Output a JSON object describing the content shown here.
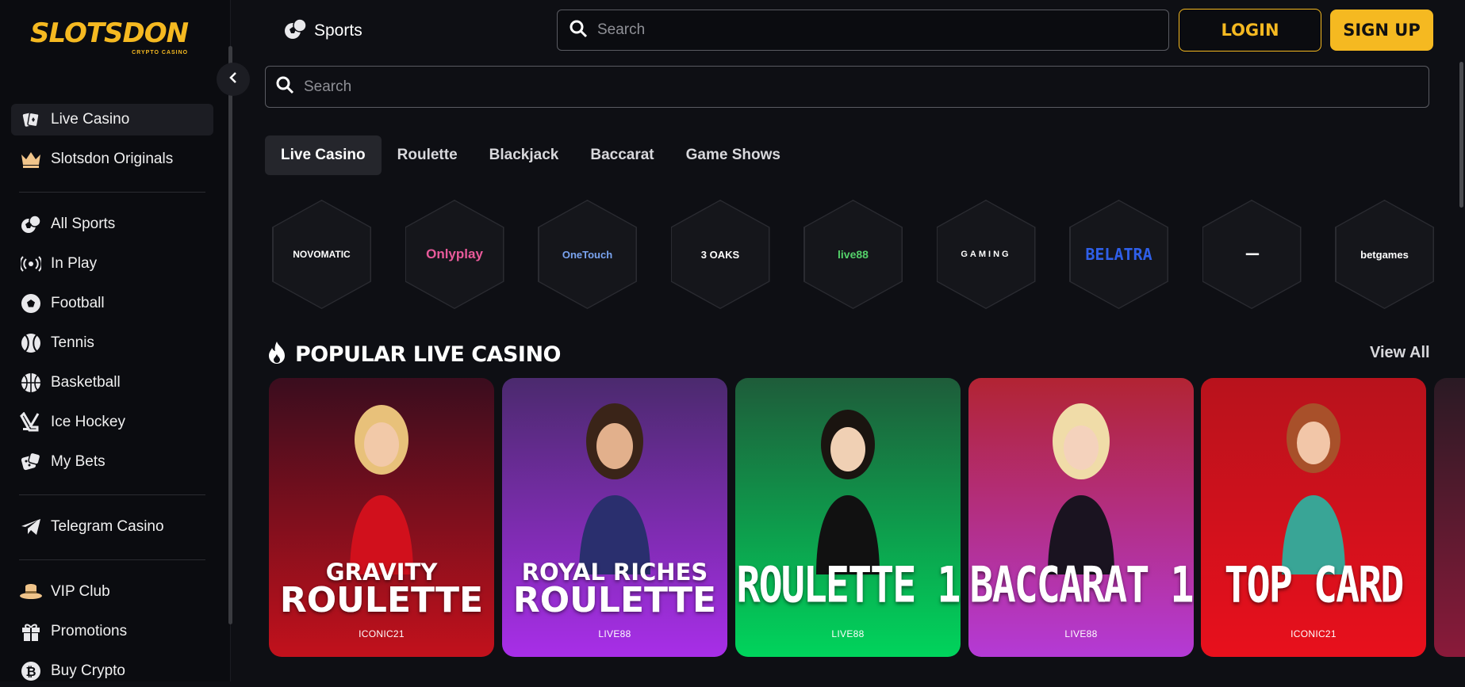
{
  "brand": {
    "name": "SLOTSDON",
    "tagline": "CRYPTO CASINO",
    "color": "#f5b921"
  },
  "header": {
    "sports_label": "Sports",
    "search_placeholder": "Search",
    "login_label": "LOGIN",
    "signup_label": "SIGN UP"
  },
  "sidebar": {
    "items": [
      {
        "label": "Live Casino",
        "icon": "live-casino-icon",
        "active": true
      },
      {
        "label": "Slotsdon Originals",
        "icon": "crown-icon"
      },
      {
        "label": "All Sports",
        "icon": "sports-icon"
      },
      {
        "label": "In Play",
        "icon": "broadcast-icon"
      },
      {
        "label": "Football",
        "icon": "football-icon"
      },
      {
        "label": "Tennis",
        "icon": "tennis-icon"
      },
      {
        "label": "Basketball",
        "icon": "basketball-icon"
      },
      {
        "label": "Ice Hockey",
        "icon": "hockey-icon"
      },
      {
        "label": "My Bets",
        "icon": "dice-icon"
      },
      {
        "label": "Telegram Casino",
        "icon": "telegram-icon"
      },
      {
        "label": "VIP Club",
        "icon": "vip-hat-icon"
      },
      {
        "label": "Promotions",
        "icon": "gift-icon"
      },
      {
        "label": "Buy Crypto",
        "icon": "bitcoin-icon"
      }
    ]
  },
  "main": {
    "search_placeholder": "Search",
    "tabs": [
      {
        "label": "Live Casino",
        "active": true
      },
      {
        "label": "Roulette"
      },
      {
        "label": "Blackjack"
      },
      {
        "label": "Baccarat"
      },
      {
        "label": "Game Shows"
      }
    ],
    "providers": [
      {
        "name": "NOVOMATIC",
        "color": "#ffffff"
      },
      {
        "name": "Onlyplay",
        "color": "#e85a9a"
      },
      {
        "name": "OneTouch",
        "color": "#5a8de8"
      },
      {
        "name": "3 OAKS",
        "color": "#ffffff"
      },
      {
        "name": "live88",
        "color": "#54d16a"
      },
      {
        "name": "GAMING",
        "color": "#ffffff"
      },
      {
        "name": "BELATRA",
        "color": "#2f5fe8"
      },
      {
        "name": "▪▪▪▪▪▪▪▪▪▪",
        "color": "#ffffff"
      },
      {
        "name": "betgames",
        "color": "#ffffff"
      }
    ],
    "section": {
      "title": "POPULAR LIVE CASINO",
      "view_all": "View All"
    },
    "games": [
      {
        "line1": "GRAVITY",
        "line2": "ROULETTE",
        "provider": "ICONIC21",
        "bg_top": "#3a0d1e",
        "bg_bottom": "#c2111c"
      },
      {
        "line1": "ROYAL RICHES",
        "line2": "ROULETTE",
        "provider": "LIVE88",
        "bg_top": "#4b2a6e",
        "bg_bottom": "#a82ee8"
      },
      {
        "line1": "ROULETTE 1",
        "provider": "LIVE88",
        "bg_top": "#1e5c3a",
        "bg_bottom": "#00d45c"
      },
      {
        "line1": "BACCARAT 1",
        "provider": "LIVE88",
        "bg_top": "#b22433",
        "bg_bottom": "#b43ad6"
      },
      {
        "line1": "TOP CARD",
        "provider": "ICONIC21",
        "bg_top": "#b8121c",
        "bg_bottom": "#e8101c"
      }
    ]
  }
}
